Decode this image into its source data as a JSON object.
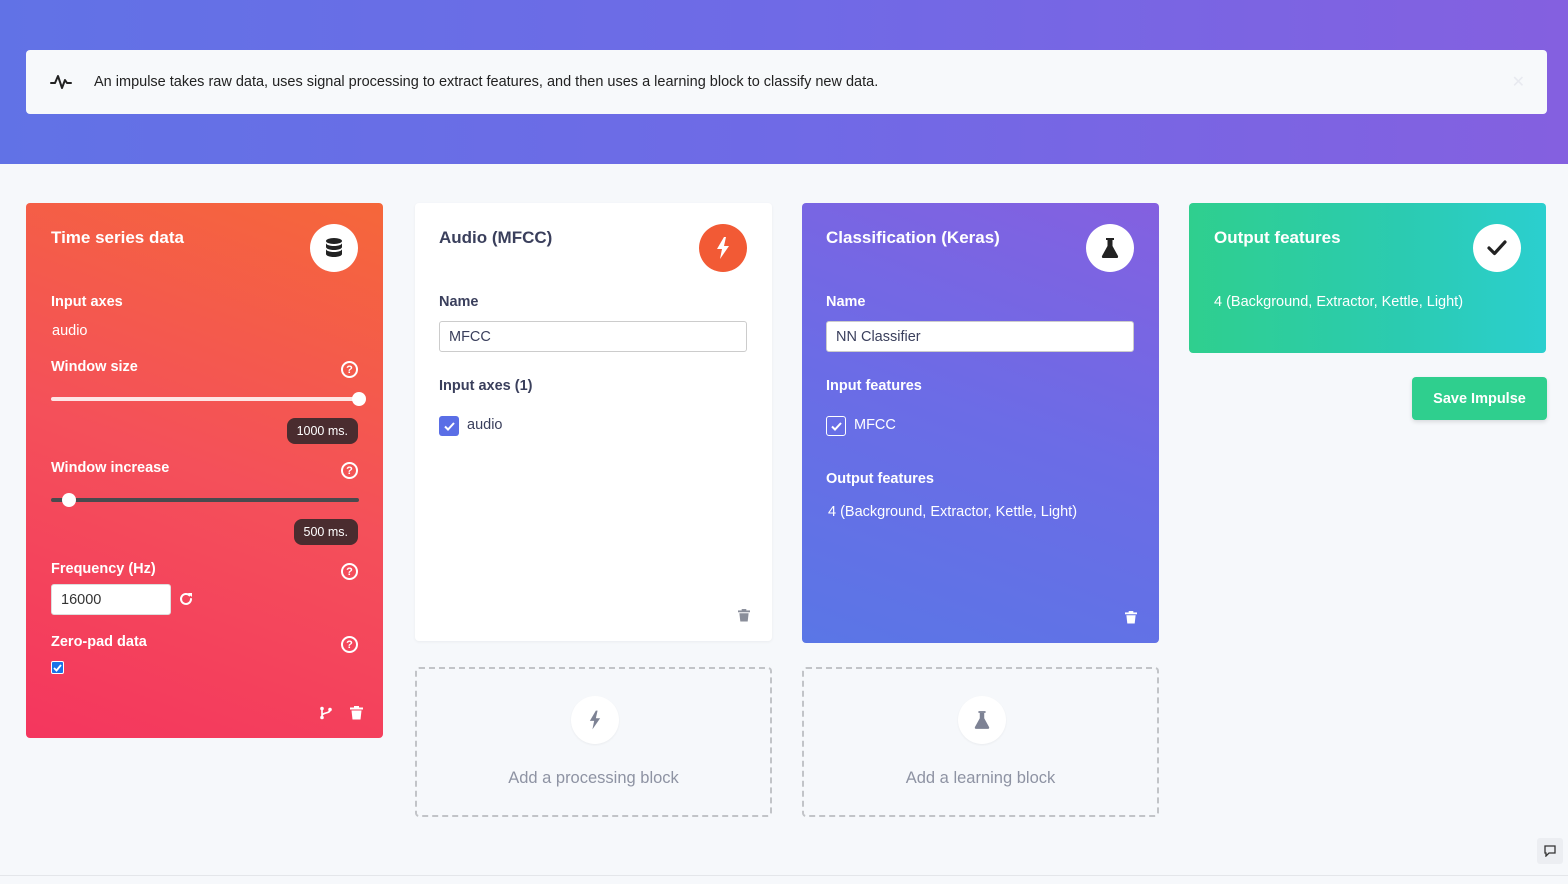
{
  "info_bar": {
    "text": "An impulse takes raw data, uses signal processing to extract features, and then uses a learning block to classify new data."
  },
  "time_series": {
    "title": "Time series data",
    "input_axes_label": "Input axes",
    "input_axes_value": "audio",
    "window_size_label": "Window size",
    "window_size_value": "1000 ms.",
    "window_size_level": 1.0,
    "window_increase_label": "Window increase",
    "window_increase_value": "500 ms.",
    "window_increase_level": 0.06,
    "frequency_label": "Frequency (Hz)",
    "frequency_value": "16000",
    "zero_pad_label": "Zero-pad data",
    "zero_pad_checked": true
  },
  "processing": {
    "title": "Audio (MFCC)",
    "name_label": "Name",
    "name_value": "MFCC",
    "input_axes_label": "Input axes (1)",
    "axis_item": "audio"
  },
  "learning": {
    "title": "Classification (Keras)",
    "name_label": "Name",
    "name_value": "NN Classifier",
    "input_features_label": "Input features",
    "input_feature_item": "MFCC",
    "output_features_label": "Output features",
    "output_features_value": "4 (Background, Extractor, Kettle, Light)"
  },
  "output": {
    "title": "Output features",
    "value": "4 (Background, Extractor, Kettle, Light)"
  },
  "save_label": "Save Impulse",
  "add_processing_label": "Add a processing block",
  "add_learning_label": "Add a learning block",
  "colors": {
    "header_gradient_start": "#6172e6",
    "header_gradient_end": "#8460e0",
    "input_block": "#f4365e",
    "processing_accent": "#f25a35",
    "learning_block": "#6b6ce6",
    "output_block": "#2fcf8e",
    "save_button": "#2fcf8e"
  }
}
